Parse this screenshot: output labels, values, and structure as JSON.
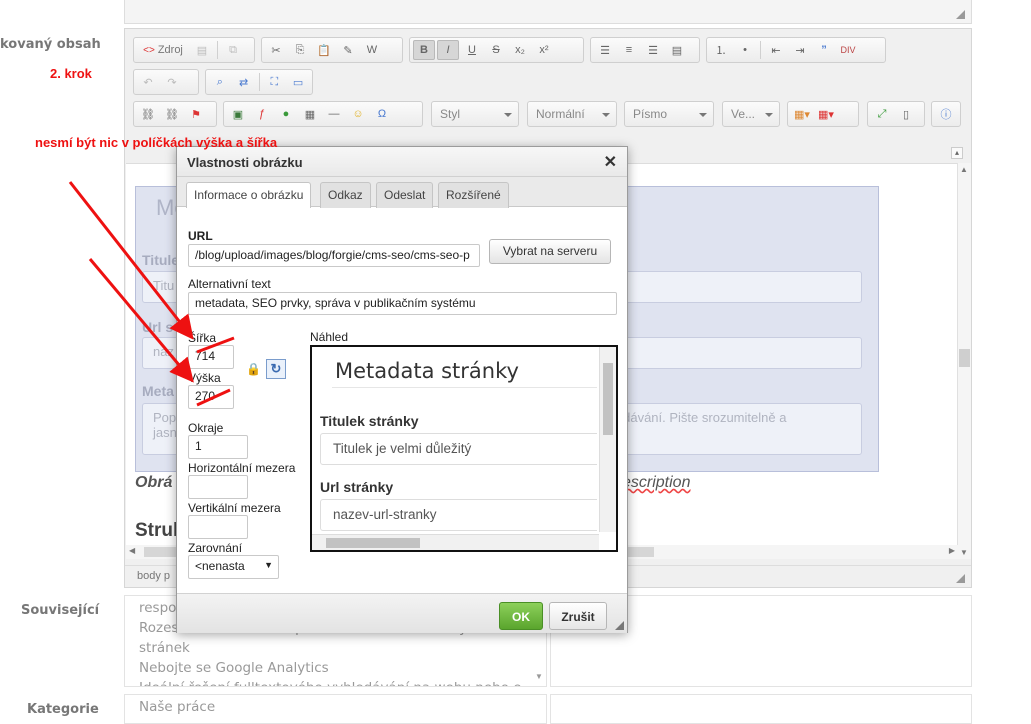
{
  "left_labels": {
    "content": "kovaný obsah",
    "related": "Související",
    "category": "Kategorie"
  },
  "annotations": {
    "step": "2. krok",
    "warning": "nesmí být nic v políčkách výška a šířka"
  },
  "toolbar": {
    "source_label": "Zdroj",
    "style_combo": "Styl",
    "format_combo": "Normální",
    "font_combo": "Písmo",
    "size_combo": "Ve..."
  },
  "editor": {
    "statusbar": "body  p",
    "caption_left": "Obrá",
    "caption_right": "escription",
    "section_heading": "Struk",
    "bg_title": "Me",
    "bg_label_title": "Titule",
    "bg_placeholder_title": "Titu",
    "bg_label_url": "Url s",
    "bg_placeholder_url": "naz",
    "bg_label_meta": "Meta",
    "bg_meta_left_1": "Pop",
    "bg_meta_left_2": "jasn",
    "bg_meta_right": "ledávání. Pište srozumitelně a"
  },
  "dialog": {
    "title": "Vlastnosti obrázku",
    "close_glyph": "✕",
    "tabs": [
      "Informace o obrázku",
      "Odkaz",
      "Odeslat",
      "Rozšířené"
    ],
    "url_label": "URL",
    "url_value": "/blog/upload/images/blog/forgie/cms-seo/cms-seo-p",
    "browse_button": "Vybrat na serveru",
    "alt_label": "Alternativní text",
    "alt_value": "metadata, SEO prvky, správa v publikačním systému",
    "width_label": "Šířka",
    "width_value": "714",
    "height_label": "Výška",
    "height_value": "270",
    "border_label": "Okraje",
    "border_value": "1",
    "hspace_label": "Horizontální mezera",
    "hspace_value": "",
    "vspace_label": "Vertikální mezera",
    "vspace_value": "",
    "align_label": "Zarovnání",
    "align_value": "<nenasta",
    "preview_label": "Náhled",
    "preview": {
      "heading": "Metadata stránky",
      "field1_label": "Titulek stránky",
      "field1_value": "Titulek je velmi důležitý",
      "field2_label": "Url stránky",
      "field2_value": "nazev-url-stranky"
    },
    "ok_button": "OK",
    "cancel_button": "Zrušit"
  },
  "related_list": [
    "respo",
    "Rozesílání newsletteru přímo z vlastních webových stránek",
    "Nebojte se Google Analytics",
    "Ideální řešení fulltextového vyhledávání na webu nebo e-sho"
  ],
  "category_list": [
    "Naše práce"
  ],
  "colors": {
    "annotation_red": "#ee1111",
    "ok_green": "#5aa52d"
  }
}
